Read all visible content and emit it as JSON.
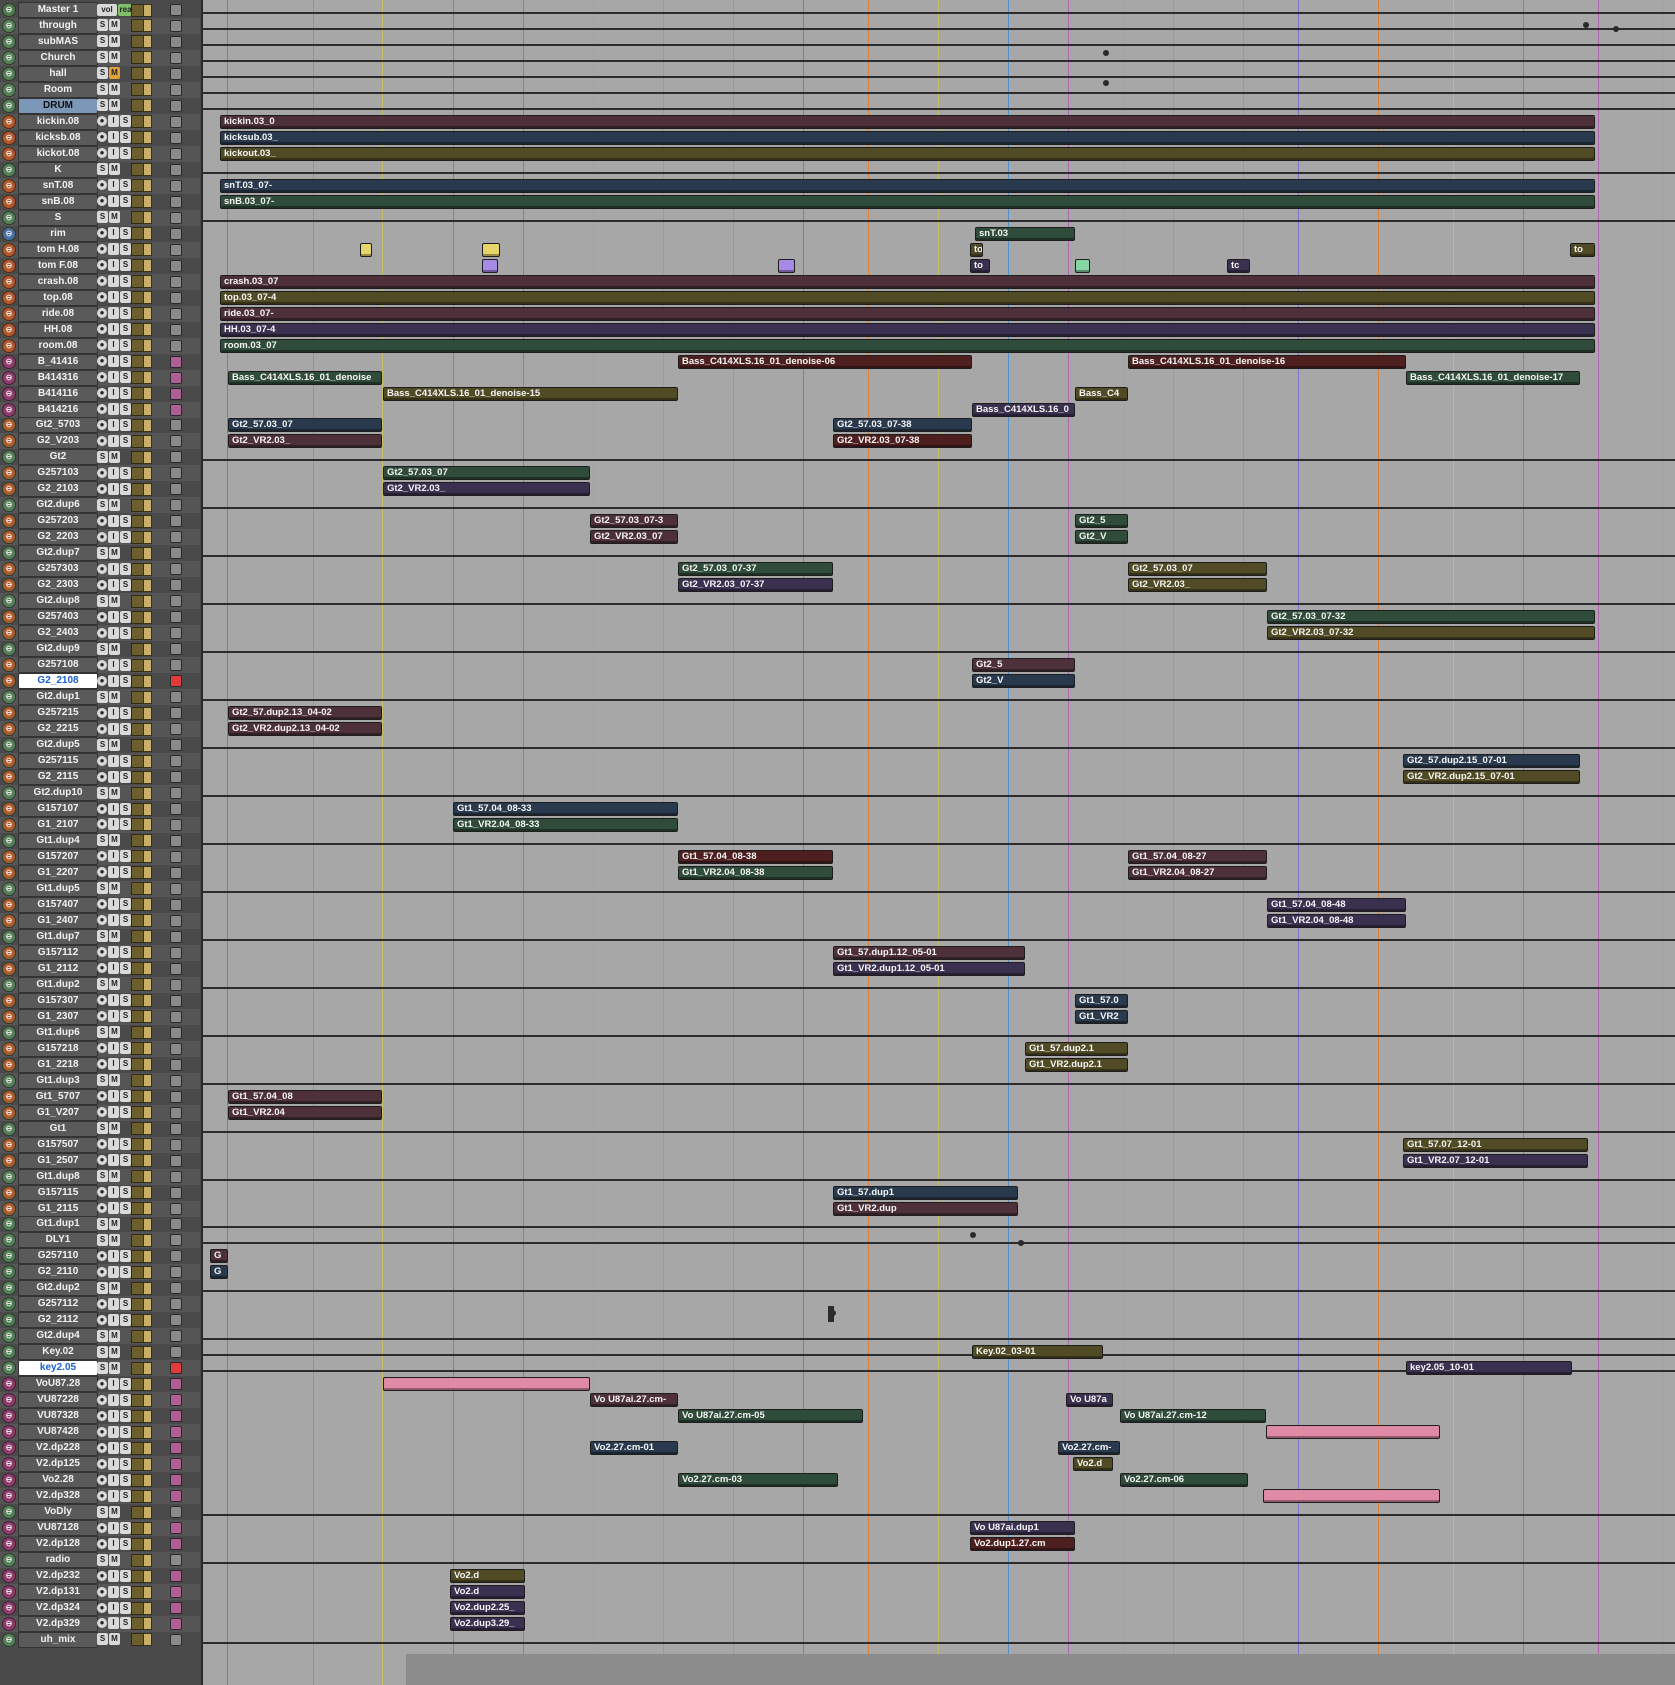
{
  "colors": {
    "grid": [
      "#7a6cd0",
      "#e07a2a",
      "#c9c35a",
      "#3e8ed6",
      "#b45ab2",
      "#c9a04a",
      "#6ac04a",
      "#5aa8d8"
    ],
    "clip_pink": "#e08aa8",
    "clip_blue": "#7aa7e0",
    "clip_green": "#86d6a4",
    "clip_yellow": "#e6d66a",
    "clip_purple": "#a78ae6",
    "clip_red": "#e05a5a",
    "clip_teal": "#6ad6c8"
  },
  "buttons": {
    "record": "●",
    "input": "I",
    "solo": "S",
    "mute": "M"
  },
  "icons": {
    "group": "group-toggle-icon",
    "output": "output-assign-icon",
    "insert": "plugin-insert-icon"
  },
  "master_badges": {
    "vol": "vol",
    "read": "read"
  },
  "tracks": [
    {
      "name": "Master 1",
      "type": "master"
    },
    {
      "name": "through",
      "type": "aux"
    },
    {
      "name": "subMAS",
      "type": "aux"
    },
    {
      "name": "Church",
      "type": "aux"
    },
    {
      "name": "hall",
      "type": "aux",
      "mute_on": true
    },
    {
      "name": "Room",
      "type": "aux"
    },
    {
      "name": "DRUM",
      "type": "header"
    },
    {
      "name": "kickin.08",
      "type": "drum"
    },
    {
      "name": "kicksb.08",
      "type": "drum"
    },
    {
      "name": "kickot.08",
      "type": "drum"
    },
    {
      "name": "K",
      "type": "aux"
    },
    {
      "name": "snT.08",
      "type": "drum"
    },
    {
      "name": "snB.08",
      "type": "drum"
    },
    {
      "name": "S",
      "type": "aux"
    },
    {
      "name": "rim",
      "type": "blue"
    },
    {
      "name": "tom H.08",
      "type": "drum"
    },
    {
      "name": "tom F.08",
      "type": "drum"
    },
    {
      "name": "crash.08",
      "type": "drum"
    },
    {
      "name": "top.08",
      "type": "drum"
    },
    {
      "name": "ride.08",
      "type": "drum"
    },
    {
      "name": "HH.08",
      "type": "drum",
      "mute_on": true
    },
    {
      "name": "room.08",
      "type": "drum"
    },
    {
      "name": "B_41416",
      "type": "vox"
    },
    {
      "name": "B414316",
      "type": "vox"
    },
    {
      "name": "B414116",
      "type": "vox"
    },
    {
      "name": "B414216",
      "type": "vox"
    },
    {
      "name": "Gt2_5703",
      "type": "gtr"
    },
    {
      "name": "G2_V203",
      "type": "gtr"
    },
    {
      "name": "Gt2",
      "type": "aux"
    },
    {
      "name": "G257103",
      "type": "gtr"
    },
    {
      "name": "G2_2103",
      "type": "gtr"
    },
    {
      "name": "Gt2.dup6",
      "type": "aux"
    },
    {
      "name": "G257203",
      "type": "gtr"
    },
    {
      "name": "G2_2203",
      "type": "gtr"
    },
    {
      "name": "Gt2.dup7",
      "type": "aux"
    },
    {
      "name": "G257303",
      "type": "gtr"
    },
    {
      "name": "G2_2303",
      "type": "gtr"
    },
    {
      "name": "Gt2.dup8",
      "type": "aux"
    },
    {
      "name": "G257403",
      "type": "gtr"
    },
    {
      "name": "G2_2403",
      "type": "gtr"
    },
    {
      "name": "Gt2.dup9",
      "type": "aux"
    },
    {
      "name": "G257108",
      "type": "gtr"
    },
    {
      "name": "G2_2108",
      "type": "gtr",
      "selected": true,
      "rec_on": true
    },
    {
      "name": "Gt2.dup1",
      "type": "aux"
    },
    {
      "name": "G257215",
      "type": "gtr"
    },
    {
      "name": "G2_2215",
      "type": "gtr"
    },
    {
      "name": "Gt2.dup5",
      "type": "aux"
    },
    {
      "name": "G257115",
      "type": "gtr"
    },
    {
      "name": "G2_2115",
      "type": "gtr"
    },
    {
      "name": "Gt2.dup10",
      "type": "aux"
    },
    {
      "name": "G157107",
      "type": "gtr"
    },
    {
      "name": "G1_2107",
      "type": "gtr"
    },
    {
      "name": "Gt1.dup4",
      "type": "aux"
    },
    {
      "name": "G157207",
      "type": "gtr"
    },
    {
      "name": "G1_2207",
      "type": "gtr"
    },
    {
      "name": "Gt1.dup5",
      "type": "aux"
    },
    {
      "name": "G157407",
      "type": "gtr"
    },
    {
      "name": "G1_2407",
      "type": "gtr"
    },
    {
      "name": "Gt1.dup7",
      "type": "aux"
    },
    {
      "name": "G157112",
      "type": "gtr"
    },
    {
      "name": "G1_2112",
      "type": "gtr"
    },
    {
      "name": "Gt1.dup2",
      "type": "aux"
    },
    {
      "name": "G157307",
      "type": "gtr"
    },
    {
      "name": "G1_2307",
      "type": "gtr"
    },
    {
      "name": "Gt1.dup6",
      "type": "aux"
    },
    {
      "name": "G157218",
      "type": "gtr"
    },
    {
      "name": "G1_2218",
      "type": "gtr"
    },
    {
      "name": "Gt1.dup3",
      "type": "aux"
    },
    {
      "name": "Gt1_5707",
      "type": "gtr"
    },
    {
      "name": "G1_V207",
      "type": "gtr"
    },
    {
      "name": "Gt1",
      "type": "aux"
    },
    {
      "name": "G157507",
      "type": "gtr"
    },
    {
      "name": "G1_2507",
      "type": "gtr"
    },
    {
      "name": "Gt1.dup8",
      "type": "aux"
    },
    {
      "name": "G157115",
      "type": "gtr"
    },
    {
      "name": "G1_2115",
      "type": "gtr"
    },
    {
      "name": "Gt1.dup1",
      "type": "aux"
    },
    {
      "name": "DLY1",
      "type": "aux"
    },
    {
      "name": "G257110",
      "type": "gray"
    },
    {
      "name": "G2_2110",
      "type": "gray"
    },
    {
      "name": "Gt2.dup2",
      "type": "aux"
    },
    {
      "name": "G257112",
      "type": "gray"
    },
    {
      "name": "G2_2112",
      "type": "gray"
    },
    {
      "name": "Gt2.dup4",
      "type": "aux"
    },
    {
      "name": "Key.02",
      "type": "aux"
    },
    {
      "name": "key2.05",
      "type": "aux",
      "selected": true,
      "rec_on": true
    },
    {
      "name": "VoU87.28",
      "type": "vox"
    },
    {
      "name": "VU87228",
      "type": "vox"
    },
    {
      "name": "VU87328",
      "type": "vox"
    },
    {
      "name": "VU87428",
      "type": "vox"
    },
    {
      "name": "V2.dp228",
      "type": "vox"
    },
    {
      "name": "V2.dp125",
      "type": "vox"
    },
    {
      "name": "Vo2.28",
      "type": "vox"
    },
    {
      "name": "V2.dp328",
      "type": "vox"
    },
    {
      "name": "VoDly",
      "type": "aux"
    },
    {
      "name": "VU87128",
      "type": "vox"
    },
    {
      "name": "V2.dp128",
      "type": "vox"
    },
    {
      "name": "radio",
      "type": "aux"
    },
    {
      "name": "V2.dp232",
      "type": "vox"
    },
    {
      "name": "V2.dp131",
      "type": "vox"
    },
    {
      "name": "V2.dp324",
      "type": "vox"
    },
    {
      "name": "V2.dp329",
      "type": "vox"
    },
    {
      "name": "uh_mix",
      "type": "aux"
    }
  ],
  "clips": [
    {
      "row": 7,
      "start": 220,
      "end": 1595,
      "label": "kickin.03_0",
      "color": "pink"
    },
    {
      "row": 8,
      "start": 220,
      "end": 1595,
      "label": "kicksub.03_",
      "color": "blue"
    },
    {
      "row": 9,
      "start": 220,
      "end": 1595,
      "label": "kickout.03_",
      "color": "yellow"
    },
    {
      "row": 11,
      "start": 220,
      "end": 1595,
      "label": "snT.03_07-",
      "color": "blue"
    },
    {
      "row": 12,
      "start": 220,
      "end": 1595,
      "label": "snB.03_07-",
      "color": "green"
    },
    {
      "row": 14,
      "start": 975,
      "end": 1075,
      "label": "snT.03",
      "color": "green"
    },
    {
      "row": 15,
      "start": 360,
      "end": 372,
      "label": "",
      "color": "yellow"
    },
    {
      "row": 15,
      "start": 482,
      "end": 500,
      "label": "",
      "color": "yellow"
    },
    {
      "row": 15,
      "start": 970,
      "end": 983,
      "label": "to",
      "color": "yellow"
    },
    {
      "row": 15,
      "start": 1570,
      "end": 1595,
      "label": "to",
      "color": "yellow"
    },
    {
      "row": 16,
      "start": 482,
      "end": 498,
      "label": "",
      "color": "purple"
    },
    {
      "row": 16,
      "start": 778,
      "end": 795,
      "label": "",
      "color": "purple"
    },
    {
      "row": 16,
      "start": 970,
      "end": 990,
      "label": "to",
      "color": "purple"
    },
    {
      "row": 16,
      "start": 1075,
      "end": 1090,
      "label": "",
      "color": "green"
    },
    {
      "row": 16,
      "start": 1227,
      "end": 1250,
      "label": "tc",
      "color": "purple"
    },
    {
      "row": 17,
      "start": 220,
      "end": 1595,
      "label": "crash.03_07",
      "color": "pink"
    },
    {
      "row": 18,
      "start": 220,
      "end": 1595,
      "label": "top.03_07-4",
      "color": "yellow"
    },
    {
      "row": 19,
      "start": 220,
      "end": 1595,
      "label": "ride.03_07-",
      "color": "pink"
    },
    {
      "row": 20,
      "start": 220,
      "end": 1595,
      "label": "HH.03_07-4",
      "color": "purple"
    },
    {
      "row": 21,
      "start": 220,
      "end": 1595,
      "label": "room.03_07",
      "color": "green"
    },
    {
      "row": 22,
      "start": 678,
      "end": 972,
      "label": "Bass_C414XLS.16_01_denoise-06",
      "color": "red"
    },
    {
      "row": 22,
      "start": 1128,
      "end": 1406,
      "label": "Bass_C414XLS.16_01_denoise-16",
      "color": "red"
    },
    {
      "row": 23,
      "start": 228,
      "end": 382,
      "label": "Bass_C414XLS.16_01_denoise",
      "color": "green"
    },
    {
      "row": 23,
      "start": 1406,
      "end": 1580,
      "label": "Bass_C414XLS.16_01_denoise-17",
      "color": "green"
    },
    {
      "row": 24,
      "start": 383,
      "end": 678,
      "label": "Bass_C414XLS.16_01_denoise-15",
      "color": "yellow"
    },
    {
      "row": 24,
      "start": 1075,
      "end": 1128,
      "label": "Bass_C4",
      "color": "yellow"
    },
    {
      "row": 25,
      "start": 972,
      "end": 1075,
      "label": "Bass_C414XLS.16_0",
      "color": "purple"
    },
    {
      "row": 26,
      "start": 228,
      "end": 382,
      "label": "Gt2_57.03_07",
      "color": "blue"
    },
    {
      "row": 26,
      "start": 833,
      "end": 972,
      "label": "Gt2_57.03_07-38",
      "color": "blue"
    },
    {
      "row": 27,
      "start": 228,
      "end": 382,
      "label": "Gt2_VR2.03_",
      "color": "pink"
    },
    {
      "row": 27,
      "start": 833,
      "end": 972,
      "label": "Gt2_VR2.03_07-38",
      "color": "red"
    },
    {
      "row": 29,
      "start": 383,
      "end": 590,
      "label": "Gt2_57.03_07",
      "color": "green"
    },
    {
      "row": 30,
      "start": 383,
      "end": 590,
      "label": "Gt2_VR2.03_",
      "color": "purple"
    },
    {
      "row": 32,
      "start": 590,
      "end": 678,
      "label": "Gt2_57.03_07-3",
      "color": "pink"
    },
    {
      "row": 32,
      "start": 1075,
      "end": 1128,
      "label": "Gt2_5",
      "color": "green"
    },
    {
      "row": 33,
      "start": 590,
      "end": 678,
      "label": "Gt2_VR2.03_07",
      "color": "pink"
    },
    {
      "row": 33,
      "start": 1075,
      "end": 1128,
      "label": "Gt2_V",
      "color": "green"
    },
    {
      "row": 35,
      "start": 678,
      "end": 833,
      "label": "Gt2_57.03_07-37",
      "color": "green"
    },
    {
      "row": 35,
      "start": 1128,
      "end": 1267,
      "label": "Gt2_57.03_07",
      "color": "yellow"
    },
    {
      "row": 36,
      "start": 678,
      "end": 833,
      "label": "Gt2_VR2.03_07-37",
      "color": "purple"
    },
    {
      "row": 36,
      "start": 1128,
      "end": 1267,
      "label": "Gt2_VR2.03_",
      "color": "yellow"
    },
    {
      "row": 38,
      "start": 1267,
      "end": 1595,
      "label": "Gt2_57.03_07-32",
      "color": "green"
    },
    {
      "row": 39,
      "start": 1267,
      "end": 1595,
      "label": "Gt2_VR2.03_07-32",
      "color": "yellow"
    },
    {
      "row": 41,
      "start": 972,
      "end": 1075,
      "label": "Gt2_5",
      "color": "pink"
    },
    {
      "row": 42,
      "start": 972,
      "end": 1075,
      "label": "Gt2_V",
      "color": "blue"
    },
    {
      "row": 44,
      "start": 228,
      "end": 382,
      "label": "Gt2_57.dup2.13_04-02",
      "color": "pink"
    },
    {
      "row": 45,
      "start": 228,
      "end": 382,
      "label": "Gt2_VR2.dup2.13_04-02",
      "color": "pink"
    },
    {
      "row": 47,
      "start": 1403,
      "end": 1580,
      "label": "Gt2_57.dup2.15_07-01",
      "color": "blue"
    },
    {
      "row": 48,
      "start": 1403,
      "end": 1580,
      "label": "Gt2_VR2.dup2.15_07-01",
      "color": "yellow"
    },
    {
      "row": 50,
      "start": 453,
      "end": 678,
      "label": "Gt1_57.04_08-33",
      "color": "blue"
    },
    {
      "row": 51,
      "start": 453,
      "end": 678,
      "label": "Gt1_VR2.04_08-33",
      "color": "green"
    },
    {
      "row": 53,
      "start": 678,
      "end": 833,
      "label": "Gt1_57.04_08-38",
      "color": "red"
    },
    {
      "row": 53,
      "start": 1128,
      "end": 1267,
      "label": "Gt1_57.04_08-27",
      "color": "pink"
    },
    {
      "row": 54,
      "start": 678,
      "end": 833,
      "label": "Gt1_VR2.04_08-38",
      "color": "green"
    },
    {
      "row": 54,
      "start": 1128,
      "end": 1267,
      "label": "Gt1_VR2.04_08-27",
      "color": "pink"
    },
    {
      "row": 56,
      "start": 1267,
      "end": 1406,
      "label": "Gt1_57.04_08-48",
      "color": "purple"
    },
    {
      "row": 57,
      "start": 1267,
      "end": 1406,
      "label": "Gt1_VR2.04_08-48",
      "color": "purple"
    },
    {
      "row": 59,
      "start": 833,
      "end": 1025,
      "label": "Gt1_57.dup1.12_05-01",
      "color": "pink"
    },
    {
      "row": 60,
      "start": 833,
      "end": 1025,
      "label": "Gt1_VR2.dup1.12_05-01",
      "color": "purple"
    },
    {
      "row": 62,
      "start": 1075,
      "end": 1128,
      "label": "Gt1_57.0",
      "color": "blue"
    },
    {
      "row": 63,
      "start": 1075,
      "end": 1128,
      "label": "Gt1_VR2",
      "color": "blue"
    },
    {
      "row": 65,
      "start": 1025,
      "end": 1128,
      "label": "Gt1_57.dup2.1",
      "color": "yellow"
    },
    {
      "row": 66,
      "start": 1025,
      "end": 1128,
      "label": "Gt1_VR2.dup2.1",
      "color": "yellow"
    },
    {
      "row": 68,
      "start": 228,
      "end": 382,
      "label": "Gt1_57.04_08",
      "color": "pink"
    },
    {
      "row": 69,
      "start": 228,
      "end": 382,
      "label": "Gt1_VR2.04",
      "color": "pink"
    },
    {
      "row": 71,
      "start": 1403,
      "end": 1588,
      "label": "Gt1_57.07_12-01",
      "color": "yellow"
    },
    {
      "row": 72,
      "start": 1403,
      "end": 1588,
      "label": "Gt1_VR2.07_12-01",
      "color": "purple"
    },
    {
      "row": 74,
      "start": 833,
      "end": 1018,
      "label": "Gt1_57.dup1",
      "color": "blue"
    },
    {
      "row": 75,
      "start": 833,
      "end": 1018,
      "label": "Gt1_VR2.dup",
      "color": "pink"
    },
    {
      "row": 78,
      "start": 210,
      "end": 228,
      "label": "G",
      "color": "pink"
    },
    {
      "row": 79,
      "start": 210,
      "end": 228,
      "label": "G",
      "color": "blue"
    },
    {
      "row": 84,
      "start": 972,
      "end": 1103,
      "label": "Key.02_03-01",
      "color": "yellow"
    },
    {
      "row": 85,
      "start": 1406,
      "end": 1572,
      "label": "key2.05_10-01",
      "color": "purple"
    },
    {
      "row": 86,
      "start": 383,
      "end": 590,
      "label": "",
      "color": "pink"
    },
    {
      "row": 87,
      "start": 590,
      "end": 678,
      "label": "Vo U87ai.27.cm-",
      "color": "pink"
    },
    {
      "row": 87,
      "start": 1066,
      "end": 1113,
      "label": "Vo U87a",
      "color": "purple"
    },
    {
      "row": 88,
      "start": 678,
      "end": 863,
      "label": "Vo U87ai.27.cm-05",
      "color": "green"
    },
    {
      "row": 88,
      "start": 1120,
      "end": 1266,
      "label": "Vo U87ai.27.cm-12",
      "color": "green"
    },
    {
      "row": 89,
      "start": 1266,
      "end": 1440,
      "label": "",
      "color": "pink"
    },
    {
      "row": 90,
      "start": 590,
      "end": 678,
      "label": "Vo2.27.cm-01",
      "color": "blue"
    },
    {
      "row": 90,
      "start": 1058,
      "end": 1120,
      "label": "Vo2.27.cm-",
      "color": "blue"
    },
    {
      "row": 91,
      "start": 1073,
      "end": 1113,
      "label": "Vo2.d",
      "color": "yellow"
    },
    {
      "row": 92,
      "start": 678,
      "end": 838,
      "label": "Vo2.27.cm-03",
      "color": "green"
    },
    {
      "row": 92,
      "start": 1120,
      "end": 1248,
      "label": "Vo2.27.cm-06",
      "color": "green"
    },
    {
      "row": 93,
      "start": 1263,
      "end": 1440,
      "label": "",
      "color": "pink"
    },
    {
      "row": 95,
      "start": 970,
      "end": 1075,
      "label": "Vo U87ai.dup1",
      "color": "purple"
    },
    {
      "row": 96,
      "start": 970,
      "end": 1075,
      "label": "Vo2.dup1.27.cm",
      "color": "red"
    },
    {
      "row": 98,
      "start": 450,
      "end": 525,
      "label": "Vo2.d",
      "color": "yellow"
    },
    {
      "row": 99,
      "start": 450,
      "end": 525,
      "label": "Vo2.d",
      "color": "purple"
    },
    {
      "row": 100,
      "start": 450,
      "end": 525,
      "label": "Vo2.dup2.25_",
      "color": "purple"
    },
    {
      "row": 101,
      "start": 450,
      "end": 525,
      "label": "Vo2.dup3.29_",
      "color": "purple"
    }
  ]
}
